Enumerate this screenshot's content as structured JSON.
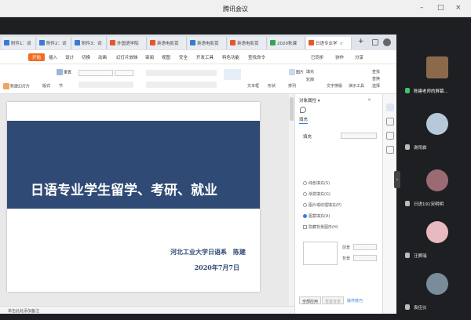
{
  "window": {
    "title": "腾讯会议",
    "controls": [
      "–",
      "□",
      "×"
    ]
  },
  "wps": {
    "doc_tabs": [
      {
        "label": "附件1：词",
        "color": "#3a7bd5",
        "active": false
      },
      {
        "label": "附件2：词",
        "color": "#3a7bd5",
        "active": false
      },
      {
        "label": "附件3：词",
        "color": "#3a7bd5",
        "active": false
      },
      {
        "label": "外国语学院",
        "color": "#e8562a",
        "active": false
      },
      {
        "label": "英语电影赏",
        "color": "#e8562a",
        "active": false
      },
      {
        "label": "英语电影赏",
        "color": "#3a7bd5",
        "active": false
      },
      {
        "label": "英语电影赏",
        "color": "#e8562a",
        "active": false
      },
      {
        "label": "2020秋课",
        "color": "#2fa84f",
        "active": false
      },
      {
        "label": "日语专业学",
        "color": "#e8562a",
        "active": true
      }
    ],
    "tab_plus": "+",
    "menu": [
      "开始",
      "插入",
      "设计",
      "切换",
      "动画",
      "幻灯片放映",
      "审阅",
      "视图",
      "安全",
      "开发工具",
      "特色功能",
      "查找命令"
    ],
    "menu_right": [
      "已同步",
      "协作",
      "分享"
    ],
    "toolbar": {
      "left": [
        "新建幻灯片",
        "版式",
        "节"
      ],
      "reset": "重置",
      "right": [
        "文本框",
        "形状",
        "排列",
        "文字排版",
        "演示工具",
        "查找",
        "替换",
        "选择"
      ],
      "picture": "图片",
      "fill": "填充",
      "outline": "轮廓"
    },
    "slide": {
      "title": "日语专业学生留学、考研、就业",
      "author": "河北工业大学日语系　陈建",
      "date": "2020年7月7日"
    },
    "status_note": "单击此处添加备注",
    "pane": {
      "title": "对象属性 ▾",
      "tab": "填充",
      "section": "填充",
      "options": [
        {
          "label": "纯色填充(S)",
          "type": "radio",
          "on": false
        },
        {
          "label": "渐变填充(G)",
          "type": "radio",
          "on": false
        },
        {
          "label": "图片或纹理填充(P)",
          "type": "radio",
          "on": false
        },
        {
          "label": "图案填充(A)",
          "type": "radio",
          "on": true
        },
        {
          "label": "隐藏背景图形(H)",
          "type": "check",
          "on": false
        }
      ],
      "fore_label": "前景",
      "back_label": "背景",
      "apply_all": "全部应用",
      "reset_bg": "重置背景",
      "link": "操作技巧"
    },
    "colors": {
      "accent": "#f26d21",
      "slide_band": "#2f4a74",
      "speaking": "#3fc36b"
    }
  },
  "participants": [
    {
      "name": "陈建老师的屏幕...",
      "speaker": true,
      "face": "#8a6a4a"
    },
    {
      "name": "谢雨霖",
      "speaker": false,
      "face": "#b7c9d8"
    },
    {
      "name": "日语191宋明明",
      "speaker": false,
      "face": "#9a6b73"
    },
    {
      "name": "汪赛瑞",
      "speaker": false,
      "face": "#e9b9c2"
    },
    {
      "name": "袁佳仪",
      "speaker": false,
      "face": "#7a8c99"
    }
  ]
}
